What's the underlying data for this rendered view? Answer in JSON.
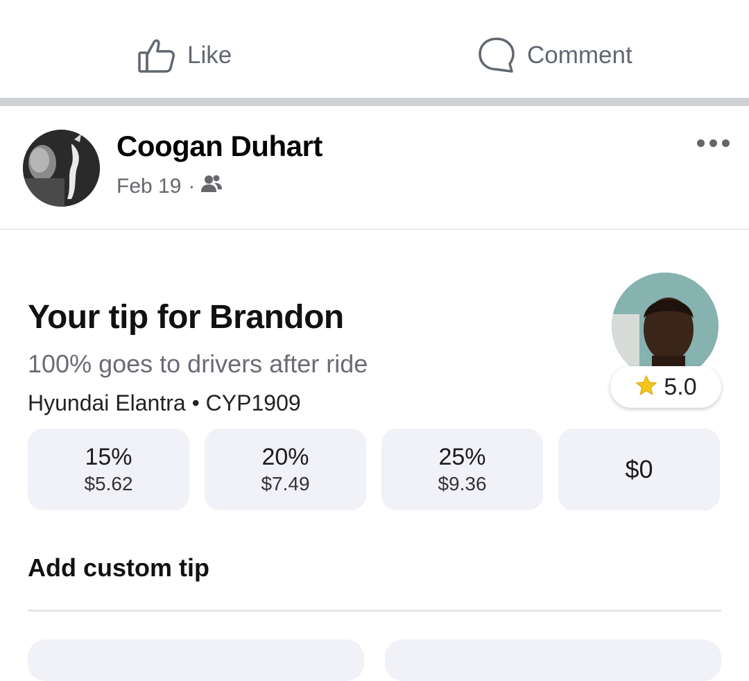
{
  "actions": {
    "like_label": "Like",
    "comment_label": "Comment"
  },
  "post": {
    "author": "Coogan Duhart",
    "date": "Feb 19",
    "separator": "·",
    "audience_icon": "friends-icon"
  },
  "tip_card": {
    "title": "Your tip for Brandon",
    "subtitle": "100% goes to drivers after ride",
    "vehicle": "Hyundai Elantra • CYP1909",
    "rating": "5.0",
    "options": [
      {
        "percent": "15%",
        "amount": "$5.62"
      },
      {
        "percent": "20%",
        "amount": "$7.49"
      },
      {
        "percent": "25%",
        "amount": "$9.36"
      },
      {
        "flat": "$0"
      }
    ],
    "custom_label": "Add custom tip"
  },
  "colors": {
    "divider": "#ced0d4",
    "option_bg": "#f1f1f8",
    "star": "#f5c518",
    "muted_text": "#65676b"
  }
}
